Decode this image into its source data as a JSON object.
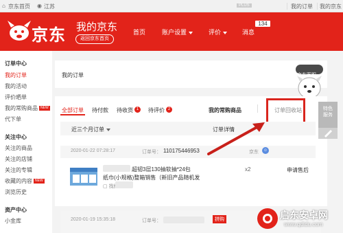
{
  "topbar": {
    "home": "京东首页",
    "location": "江苏",
    "plus": "PLUS",
    "my_orders": "我的订单",
    "my_jd": "我的京东"
  },
  "header": {
    "logo_text": "京东",
    "my_jd": "我的京东",
    "back_home": "返回京东首页",
    "nav": [
      {
        "label": "首页"
      },
      {
        "label": "账户设置"
      },
      {
        "label": "评价"
      },
      {
        "label": "消息"
      }
    ],
    "msg_count": "134"
  },
  "sidebar": {
    "sections": [
      {
        "title": "订单中心",
        "items": [
          "我的订单",
          "我的活动",
          "评价晒单",
          "我的常购商品",
          "代下单"
        ]
      },
      {
        "title": "关注中心",
        "items": [
          "关注的商品",
          "关注的店铺",
          "关注的专辑",
          "收藏的内容",
          "浏览历史"
        ]
      },
      {
        "title": "资产中心",
        "items": [
          "小金库"
        ]
      }
    ],
    "new_badge": "NEW"
  },
  "main": {
    "title": "我的订单",
    "service_label": "京东客服",
    "tabs": [
      {
        "label": "全部订单",
        "badge": ""
      },
      {
        "label": "待付款",
        "badge": ""
      },
      {
        "label": "待收货",
        "badge": "1"
      },
      {
        "label": "待评价",
        "badge": "2"
      }
    ],
    "frequent": "我的常购商品",
    "recycle_bin": "订单回收站",
    "filter": "近三个月订单",
    "detail_header": "订单详情",
    "orders": [
      {
        "date": "2020-01-22 07:28:17",
        "order_label": "订单号：",
        "order_no": "110175446953",
        "shop": "京东",
        "product": "超韧3层130抽软抽*24包",
        "product_line2": "纸巾(小规格)整箱销售（新旧产品随机发",
        "find_similar": "找搭配",
        "qty": "x2",
        "after_sale": "申请售后"
      },
      {
        "date": "2020-01-19 15:35:18",
        "order_label": "订单号：",
        "badge": "拼购"
      }
    ]
  },
  "float": {
    "special": "特色服务"
  },
  "watermark": {
    "text": "启东安卓网",
    "url": "www.qdtdu.com"
  }
}
